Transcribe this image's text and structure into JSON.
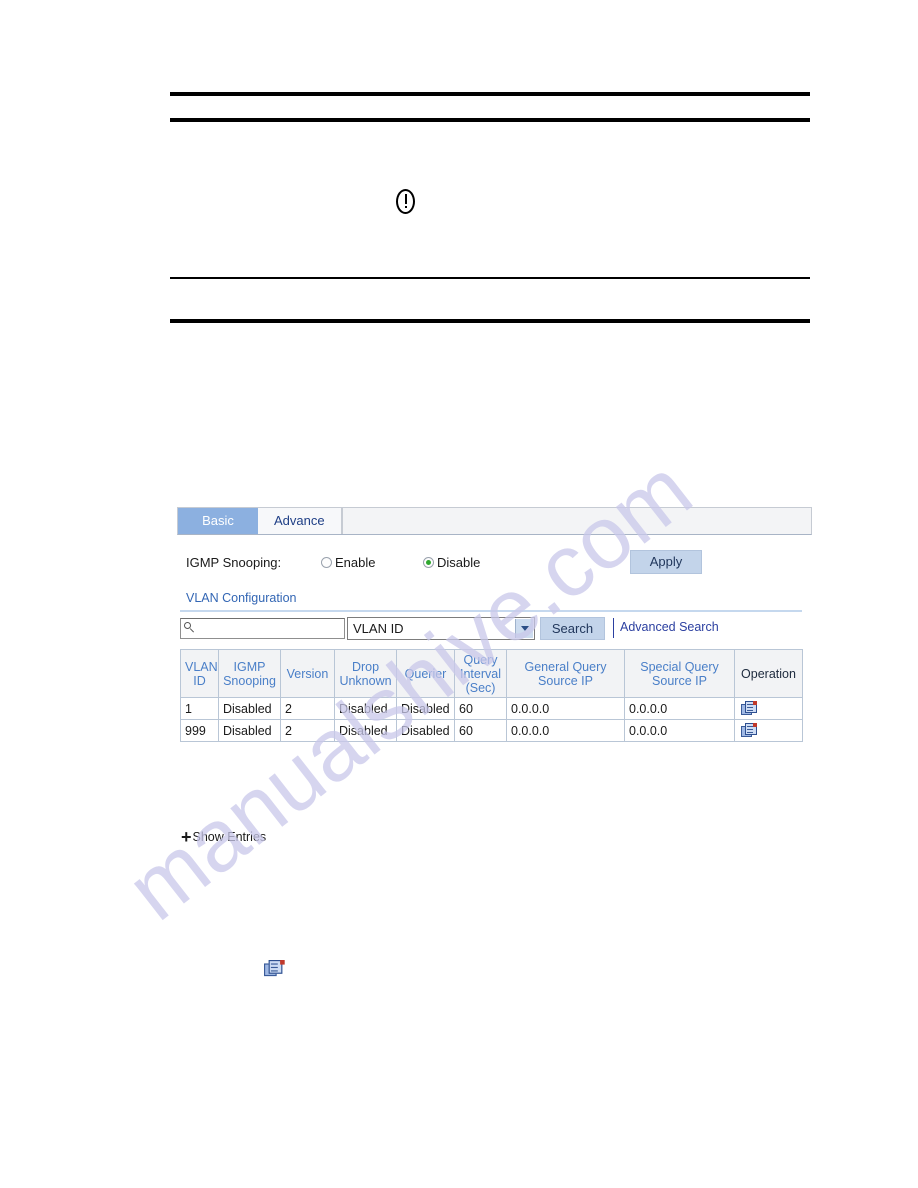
{
  "page": {
    "watermark": "manualshive.com",
    "caution_icon": "caution-exclamation-icon"
  },
  "web_ui": {
    "tabs": [
      {
        "label": "Basic",
        "active": true
      },
      {
        "label": "Advance",
        "active": false
      }
    ],
    "igmp_snooping": {
      "label": "IGMP Snooping:",
      "options": [
        {
          "label": "Enable",
          "selected": false
        },
        {
          "label": "Disable",
          "selected": true
        }
      ],
      "apply_label": "Apply"
    },
    "section": {
      "title": "VLAN Configuration"
    },
    "search": {
      "input_value": "",
      "input_placeholder": "",
      "search_icon": "magnifier-icon",
      "filter_selected": "VLAN ID",
      "filter_options": [
        "VLAN ID"
      ],
      "search_label": "Search",
      "advanced_search_label": "Advanced Search"
    },
    "table": {
      "columns": [
        "VLAN ID",
        "IGMP Snooping",
        "Version",
        "Drop Unknown",
        "Querier",
        "Query Interval (Sec)",
        "General Query Source IP",
        "Special Query Source IP",
        "Operation"
      ],
      "rows": [
        {
          "vlan_id": "1",
          "igmp_snooping": "Disabled",
          "version": "2",
          "drop_unknown": "Disabled",
          "querier": "Disabled",
          "query_interval": "60",
          "general_query_source_ip": "0.0.0.0",
          "special_query_source_ip": "0.0.0.0",
          "operation_icon": "edit-entry-icon"
        },
        {
          "vlan_id": "999",
          "igmp_snooping": "Disabled",
          "version": "2",
          "drop_unknown": "Disabled",
          "querier": "Disabled",
          "query_interval": "60",
          "general_query_source_ip": "0.0.0.0",
          "special_query_source_ip": "0.0.0.0",
          "operation_icon": "edit-entry-icon"
        }
      ]
    },
    "show_entries": {
      "plus": "+",
      "label": "Show Entries"
    },
    "legend_icon": "edit-entry-icon"
  },
  "colors": {
    "tab_active_bg": "#8cb0e0",
    "link": "#2b3fa0",
    "header_text": "#4a7fc8",
    "button_bg": "#c3d4ea",
    "radio_selected": "#2fa82f",
    "watermark": "#c9c8ea"
  }
}
